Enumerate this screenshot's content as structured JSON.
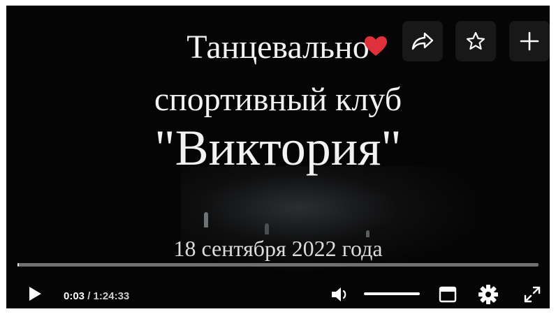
{
  "video": {
    "title_line1": "Танцевально",
    "title_line2": "спортивный клуб",
    "title_line3": "\"Виктория\"",
    "date_line": "18 сентября 2022 года",
    "progress_fraction": 0.0006
  },
  "actions": {
    "like_icon": "heart-icon",
    "share_icon": "share-icon",
    "favorite_icon": "star-icon",
    "add_icon": "plus-icon",
    "like_color": "#e0313b"
  },
  "controls": {
    "current_time": "0:03",
    "separator": " / ",
    "duration": "1:24:33",
    "play_icon": "play-icon",
    "volume_icon": "volume-icon",
    "miniplayer_icon": "window-icon",
    "settings_icon": "gear-icon",
    "fullscreen_icon": "expand-icon"
  }
}
